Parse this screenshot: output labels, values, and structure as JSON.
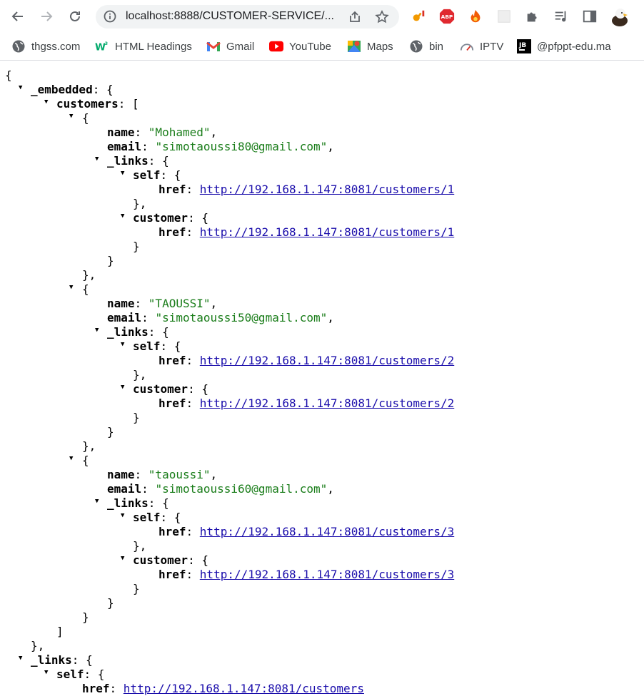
{
  "browser": {
    "url": "localhost:8888/CUSTOMER-SERVICE/...",
    "bookmarks": [
      {
        "label": "thgss.com",
        "icon": "globe-icon"
      },
      {
        "label": "HTML Headings",
        "icon": "w3schools-icon"
      },
      {
        "label": "Gmail",
        "icon": "gmail-icon"
      },
      {
        "label": "YouTube",
        "icon": "youtube-icon"
      },
      {
        "label": "Maps",
        "icon": "maps-icon"
      },
      {
        "label": "bin",
        "icon": "globe-icon"
      },
      {
        "label": "IPTV",
        "icon": "gauge-icon"
      },
      {
        "label": "@pfppt-edu.ma",
        "icon": "jetbrains-icon"
      }
    ],
    "extensions": [
      "key-icon",
      "adblock-icon",
      "flame-icon",
      "blank-extension-icon",
      "puzzle-icon",
      "media-icon",
      "side-panel-icon",
      "avatar"
    ],
    "colors": {
      "string": "#1a7d1a",
      "link": "#1a0dab"
    }
  },
  "json": {
    "customers": [
      {
        "name": "\"Mohamed\"",
        "email": "\"simotaoussi80@gmail.com\"",
        "self_href": "http://192.168.1.147:8081/customers/1",
        "customer_href": "http://192.168.1.147:8081/customers/1"
      },
      {
        "name": "\"TAOUSSI\"",
        "email": "\"simotaoussi50@gmail.com\"",
        "self_href": "http://192.168.1.147:8081/customers/2",
        "customer_href": "http://192.168.1.147:8081/customers/2"
      },
      {
        "name": "\"taoussi\"",
        "email": "\"simotaoussi60@gmail.com\"",
        "self_href": "http://192.168.1.147:8081/customers/3",
        "customer_href": "http://192.168.1.147:8081/customers/3"
      }
    ],
    "root_self_href": "http://192.168.1.147:8081/customers"
  }
}
